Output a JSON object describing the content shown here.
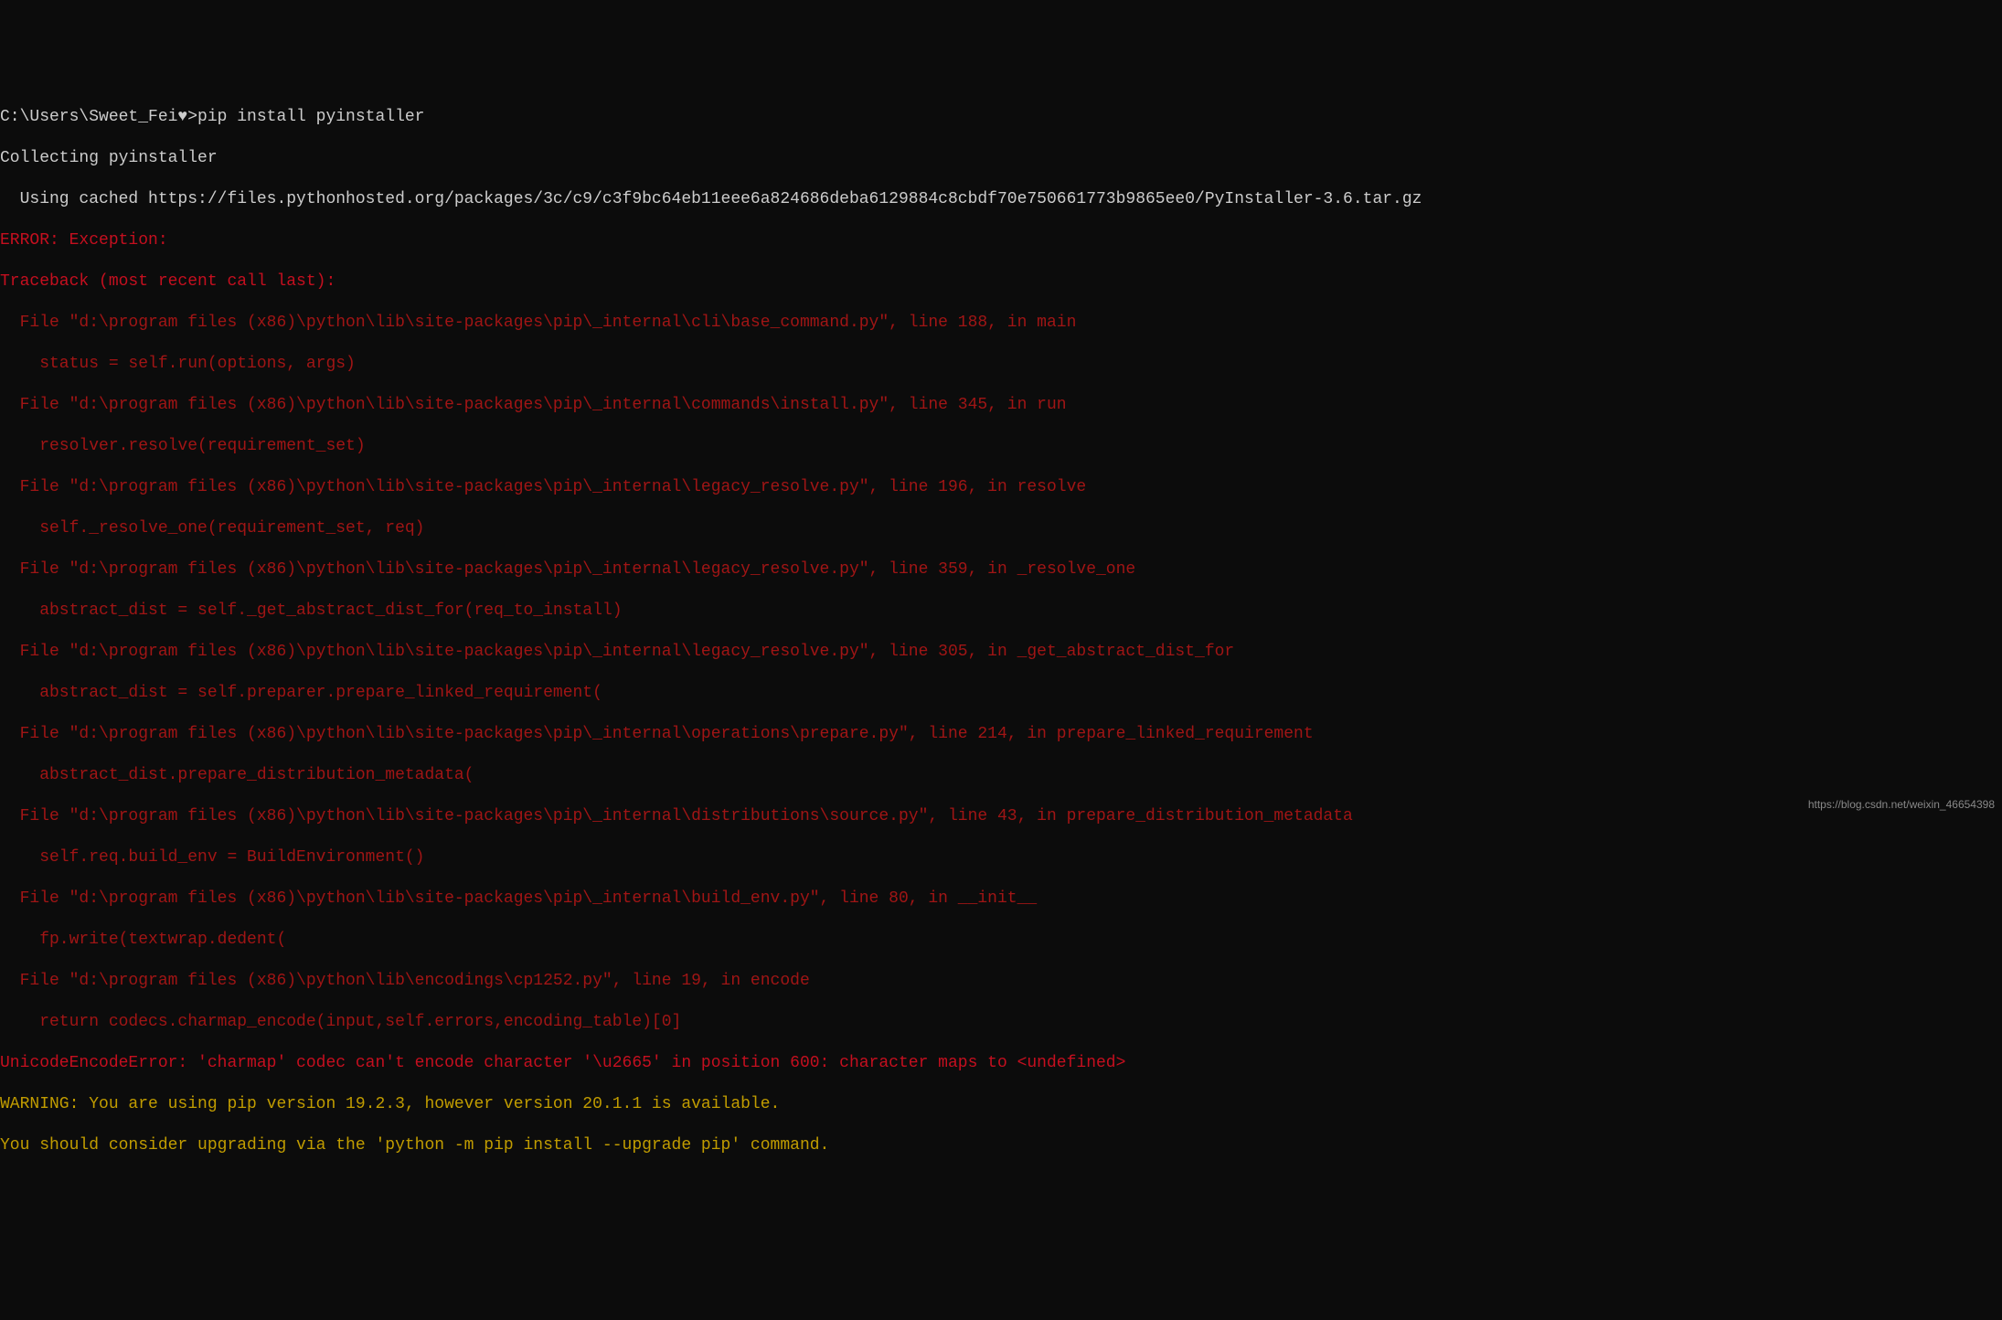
{
  "terminal": {
    "prompt_line": "C:\\Users\\Sweet_Fei♥>pip install pyinstaller",
    "collecting": "Collecting pyinstaller",
    "using_cached": "  Using cached https://files.pythonhosted.org/packages/3c/c9/c3f9bc64eb11eee6a824686deba6129884c8cbdf70e750661773b9865ee0/PyInstaller-3.6.tar.gz",
    "error_header": "ERROR: Exception:",
    "traceback_header": "Traceback (most recent call last):",
    "tb_lines": [
      "  File \"d:\\program files (x86)\\python\\lib\\site-packages\\pip\\_internal\\cli\\base_command.py\", line 188, in main",
      "    status = self.run(options, args)",
      "  File \"d:\\program files (x86)\\python\\lib\\site-packages\\pip\\_internal\\commands\\install.py\", line 345, in run",
      "    resolver.resolve(requirement_set)",
      "  File \"d:\\program files (x86)\\python\\lib\\site-packages\\pip\\_internal\\legacy_resolve.py\", line 196, in resolve",
      "    self._resolve_one(requirement_set, req)",
      "  File \"d:\\program files (x86)\\python\\lib\\site-packages\\pip\\_internal\\legacy_resolve.py\", line 359, in _resolve_one",
      "    abstract_dist = self._get_abstract_dist_for(req_to_install)",
      "  File \"d:\\program files (x86)\\python\\lib\\site-packages\\pip\\_internal\\legacy_resolve.py\", line 305, in _get_abstract_dist_for",
      "    abstract_dist = self.preparer.prepare_linked_requirement(",
      "  File \"d:\\program files (x86)\\python\\lib\\site-packages\\pip\\_internal\\operations\\prepare.py\", line 214, in prepare_linked_requirement",
      "    abstract_dist.prepare_distribution_metadata(",
      "  File \"d:\\program files (x86)\\python\\lib\\site-packages\\pip\\_internal\\distributions\\source.py\", line 43, in prepare_distribution_metadata",
      "    self.req.build_env = BuildEnvironment()",
      "  File \"d:\\program files (x86)\\python\\lib\\site-packages\\pip\\_internal\\build_env.py\", line 80, in __init__",
      "    fp.write(textwrap.dedent(",
      "  File \"d:\\program files (x86)\\python\\lib\\encodings\\cp1252.py\", line 19, in encode",
      "    return codecs.charmap_encode(input,self.errors,encoding_table)[0]"
    ],
    "unicode_error": "UnicodeEncodeError: 'charmap' codec can't encode character '\\u2665' in position 600: character maps to <undefined>",
    "warning_line1": "WARNING: You are using pip version 19.2.3, however version 20.1.1 is available.",
    "warning_line2": "You should consider upgrading via the 'python -m pip install --upgrade pip' command."
  },
  "watermark": "https://blog.csdn.net/weixin_46654398"
}
